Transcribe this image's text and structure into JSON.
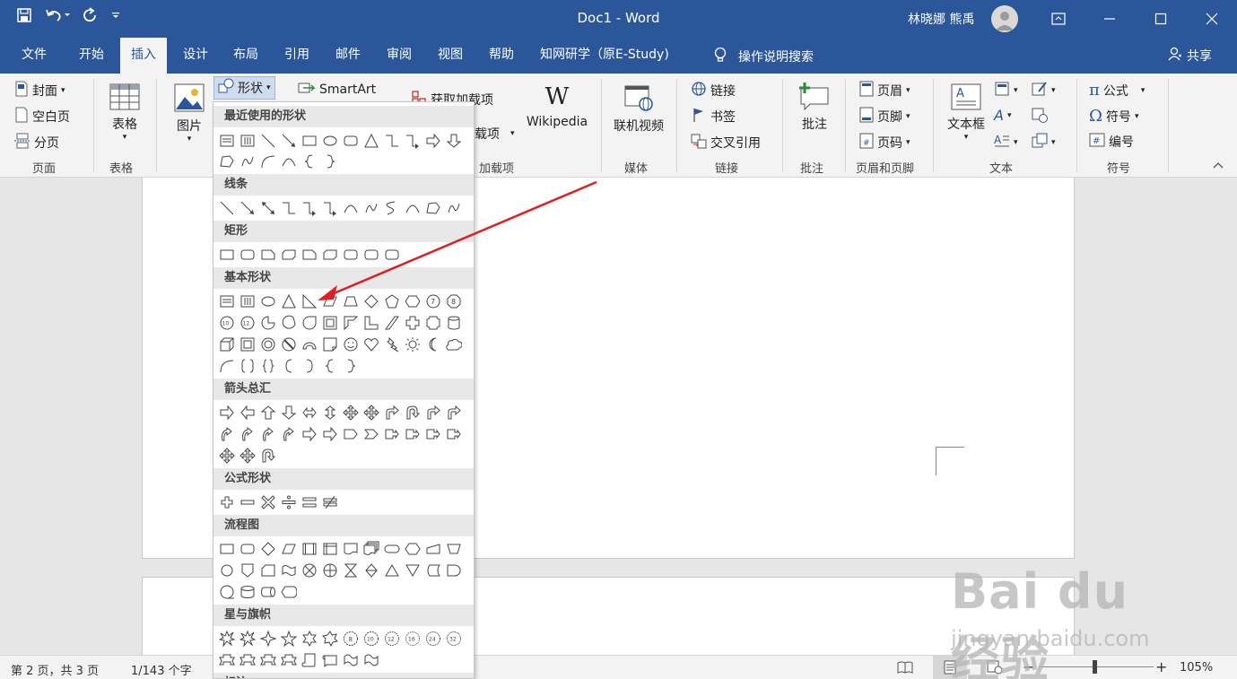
{
  "window": {
    "title": "Doc1 - Word",
    "user": "林晓娜 熊禹"
  },
  "tabs": [
    {
      "label": "文件"
    },
    {
      "label": "开始"
    },
    {
      "label": "插入"
    },
    {
      "label": "设计"
    },
    {
      "label": "布局"
    },
    {
      "label": "引用"
    },
    {
      "label": "邮件"
    },
    {
      "label": "审阅"
    },
    {
      "label": "视图"
    },
    {
      "label": "帮助"
    },
    {
      "label": "知网研学（原E-Study)"
    }
  ],
  "tellme": "操作说明搜索",
  "share": "共享",
  "ribbon": {
    "pages": {
      "cover": "封面",
      "blank": "空白页",
      "break": "分页",
      "label": "页面"
    },
    "tables": {
      "table": "表格",
      "label": "表格"
    },
    "illustrations": {
      "pictures": "图片",
      "shapes": "形状",
      "smartart": "SmartArt"
    },
    "addins": {
      "get": "获取加载项",
      "my": "载项",
      "wikipedia": "Wikipedia",
      "label": "加载项"
    },
    "media": {
      "video": "联机视频",
      "label": "媒体"
    },
    "links": {
      "link": "链接",
      "bookmark": "书签",
      "crossref": "交叉引用",
      "label": "链接"
    },
    "comments": {
      "comment": "批注",
      "label": "批注"
    },
    "headerfooter": {
      "header": "页眉",
      "footer": "页脚",
      "pagenum": "页码",
      "label": "页眉和页脚"
    },
    "text": {
      "textbox": "文本框",
      "label": "文本"
    },
    "symbols": {
      "equation": "公式",
      "symbol": "符号",
      "number": "编号",
      "label": "符号"
    }
  },
  "shapes_menu": {
    "sections": [
      "最近使用的形状",
      "线条",
      "矩形",
      "基本形状",
      "箭头总汇",
      "公式形状",
      "流程图",
      "星与旗帜",
      "标注"
    ]
  },
  "status": {
    "page": "第 2 页，共 3 页",
    "words": "1/143 个字",
    "zoom": "105%"
  },
  "watermark": {
    "main": "Bai du 经验",
    "sub": "jingyan.baidu.com"
  }
}
